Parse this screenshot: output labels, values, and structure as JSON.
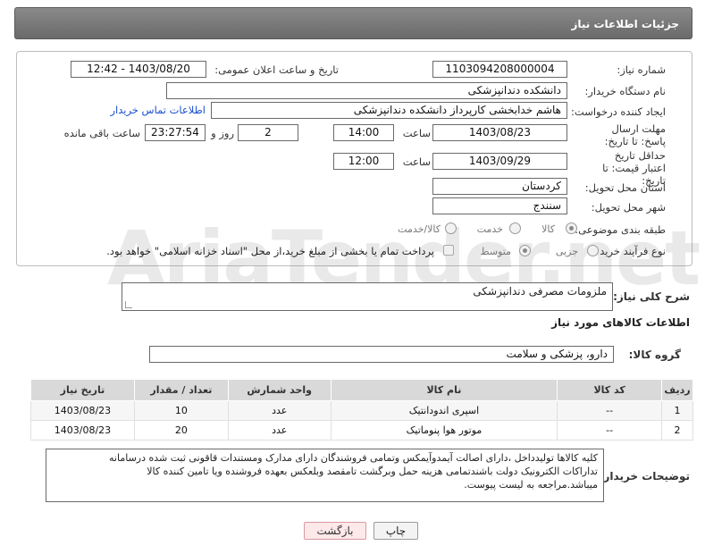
{
  "page": {
    "title": "جزئیات اطلاعات نیاز",
    "watermark": "AriaTender.net"
  },
  "details": {
    "need_number_label": "شماره نیاز:",
    "need_number": "1103094208000004",
    "announce_label": "تاریخ و ساعت اعلان عمومی:",
    "announce_value": "1403/08/20 - 12:42",
    "buyer_org_label": "نام دستگاه خریدار:",
    "buyer_org": "دانشکده دندانپزشکی",
    "requester_label": "ایجاد کننده درخواست:",
    "requester": "هاشم خدابخشی کارپرداز دانشکده دندانپزشکی",
    "buyer_contact_link": "اطلاعات تماس خریدار",
    "deadline_label": "مهلت ارسال پاسخ: تا تاریخ:",
    "deadline_date": "1403/08/23",
    "time_label": "ساعت",
    "deadline_time": "14:00",
    "days_value": "2",
    "days_label": "روز و",
    "remaining_value": "23:27:54",
    "remaining_label": "ساعت باقی مانده",
    "validity_label": "حداقل تاریخ اعتبار قیمت: تا تاریخ:",
    "validity_date": "1403/09/29",
    "validity_time": "12:00",
    "province_label": "استان محل تحویل:",
    "province": "کردستان",
    "city_label": "شهر محل تحویل:",
    "city": "سنندج",
    "category_label": "طبقه بندی موضوعی:",
    "category_options": [
      "کالا",
      "خدمت",
      "کالا/خدمت"
    ],
    "category_selected": "کالا",
    "process_label": "نوع فرآیند خرید :",
    "process_options": [
      "جزیی",
      "متوسط"
    ],
    "process_selected": "متوسط",
    "payment_note": "پرداخت تمام یا بخشی از مبلغ خرید،از محل \"اسناد خزانه اسلامی\" خواهد بود."
  },
  "summary": {
    "label": "شرح کلی نیاز:",
    "value": "ملزومات مصرفی دندانپزشکی"
  },
  "goods": {
    "section_title": "اطلاعات کالاهای مورد نیاز",
    "group_label": "گروه کالا:",
    "group_value": "دارو، پزشکی و سلامت",
    "columns": [
      "ردیف",
      "کد کالا",
      "نام کالا",
      "واحد شمارش",
      "تعداد / مقدار",
      "تاریخ نیاز"
    ],
    "rows": [
      {
        "row": "1",
        "code": "--",
        "name": "اسپری اندودانتیک",
        "unit": "عدد",
        "qty": "10",
        "date": "1403/08/23"
      },
      {
        "row": "2",
        "code": "--",
        "name": "موتور هوا پنوماتیک",
        "unit": "عدد",
        "qty": "20",
        "date": "1403/08/23"
      }
    ]
  },
  "buyer_notes": {
    "label": "توضیحات خریدار:",
    "line1": "کلیه کالاها تولیدداخل ،دارای اصالت آیمدوآیمکس وتمامی فروشندگان دارای مدارک ومستندات قاقونی ثبت شده درسامانه",
    "line2": "تداراکات الکترونیک دولت باشندتمامی هزینه حمل وبرگشت  تامقصد وبلعکس بعهده فروشنده ویا تامین کننده کالا",
    "line3": "میباشد.مراجعه به لیست پیوست."
  },
  "buttons": {
    "print": "چاپ",
    "back": "بازگشت"
  }
}
